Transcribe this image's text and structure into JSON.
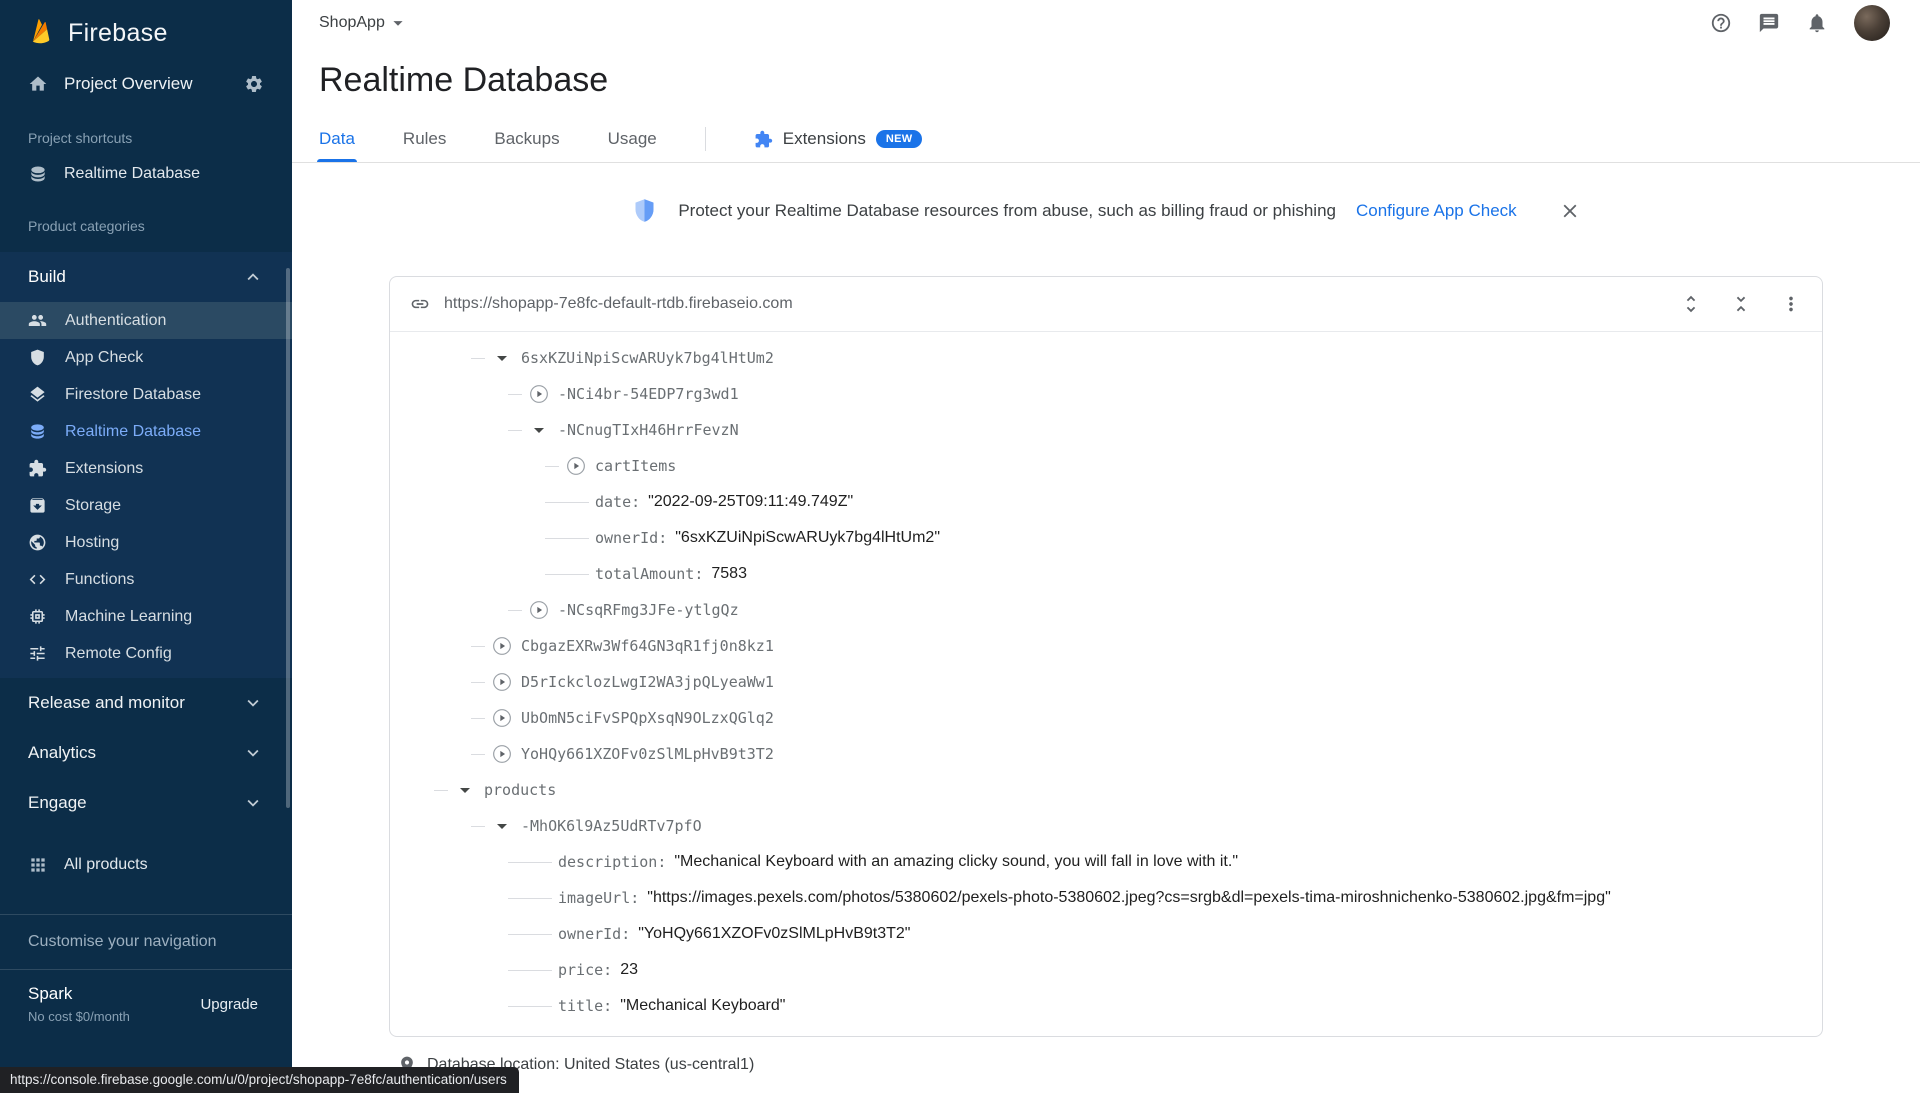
{
  "sidebar": {
    "brand": "Firebase",
    "project_overview": {
      "label": "Project Overview",
      "icon": "home-icon",
      "settings_icon": "gear-icon"
    },
    "shortcuts_label": "Project shortcuts",
    "shortcuts": [
      {
        "label": "Realtime Database",
        "icon": "database-icon"
      }
    ],
    "categories_label": "Product categories",
    "build": {
      "label": "Build",
      "items": [
        {
          "label": "Authentication",
          "icon": "people-icon",
          "state": "hover"
        },
        {
          "label": "App Check",
          "icon": "shield-icon"
        },
        {
          "label": "Firestore Database",
          "icon": "layers-icon"
        },
        {
          "label": "Realtime Database",
          "icon": "database-icon",
          "state": "active"
        },
        {
          "label": "Extensions",
          "icon": "puzzle-icon"
        },
        {
          "label": "Storage",
          "icon": "archive-icon"
        },
        {
          "label": "Hosting",
          "icon": "globe-icon"
        },
        {
          "label": "Functions",
          "icon": "code-icon"
        },
        {
          "label": "Machine Learning",
          "icon": "chip-icon"
        },
        {
          "label": "Remote Config",
          "icon": "tune-icon"
        }
      ]
    },
    "sections": [
      {
        "label": "Release and monitor"
      },
      {
        "label": "Analytics"
      },
      {
        "label": "Engage"
      }
    ],
    "all_products": "All products",
    "customise": "Customise your navigation",
    "plan": {
      "name": "Spark",
      "detail": "No cost $0/month",
      "upgrade_label": "Upgrade"
    }
  },
  "topbar": {
    "project_selector": "ShopApp"
  },
  "page": {
    "title": "Realtime Database",
    "tabs": [
      {
        "label": "Data",
        "active": true
      },
      {
        "label": "Rules"
      },
      {
        "label": "Backups"
      },
      {
        "label": "Usage"
      }
    ],
    "extensions_tab": {
      "label": "Extensions",
      "badge": "NEW"
    }
  },
  "banner": {
    "text": "Protect your Realtime Database resources from abuse, such as billing fraud or phishing",
    "action": "Configure App Check"
  },
  "db_card": {
    "url": "https://shopapp-7e8fc-default-rtdb.firebaseio.com",
    "tree": [
      {
        "depth": 1,
        "toggle": "expanded",
        "key": "6sxKZUiNpiScwARUyk7bg4lHtUm2"
      },
      {
        "depth": 2,
        "toggle": "collapsed",
        "key": "-NCi4br-54EDP7rg3wd1"
      },
      {
        "depth": 2,
        "toggle": "expanded",
        "key": "-NCnugTIxH46HrrFevzN"
      },
      {
        "depth": 3,
        "toggle": "collapsed",
        "key": "cartItems"
      },
      {
        "depth": 3,
        "toggle": "leaf",
        "key": "date",
        "value": "2022-09-25T09:11:49.749Z",
        "value_type": "string"
      },
      {
        "depth": 3,
        "toggle": "leaf",
        "key": "ownerId",
        "value": "6sxKZUiNpiScwARUyk7bg4lHtUm2",
        "value_type": "string"
      },
      {
        "depth": 3,
        "toggle": "leaf",
        "key": "totalAmount",
        "value": "7583",
        "value_type": "number"
      },
      {
        "depth": 2,
        "toggle": "collapsed",
        "key": "-NCsqRFmg3JFe-ytlgQz"
      },
      {
        "depth": 1,
        "toggle": "collapsed",
        "key": "CbgazEXRw3Wf64GN3qR1fj0n8kz1"
      },
      {
        "depth": 1,
        "toggle": "collapsed",
        "key": "D5rIckclozLwgI2WA3jpQLyeaWw1"
      },
      {
        "depth": 1,
        "toggle": "collapsed",
        "key": "UbOmN5ciFvSPQpXsqN9OLzxQGlq2"
      },
      {
        "depth": 1,
        "toggle": "collapsed",
        "key": "YoHQy661XZOFv0zSlMLpHvB9t3T2"
      },
      {
        "depth": 0,
        "toggle": "expanded",
        "key": "products"
      },
      {
        "depth": 1,
        "toggle": "expanded",
        "key": "-MhOK6l9Az5UdRTv7pfO"
      },
      {
        "depth": 2,
        "toggle": "leaf",
        "key": "description",
        "value": "Mechanical Keyboard with an amazing clicky sound, you will fall in love with it.",
        "value_type": "string"
      },
      {
        "depth": 2,
        "toggle": "leaf",
        "key": "imageUrl",
        "value": "https://images.pexels.com/photos/5380602/pexels-photo-5380602.jpeg?cs=srgb&dl=pexels-tima-miroshnichenko-5380602.jpg&fm=jpg",
        "value_type": "string"
      },
      {
        "depth": 2,
        "toggle": "leaf",
        "key": "ownerId",
        "value": "YoHQy661XZOFv0zSlMLpHvB9t3T2",
        "value_type": "string"
      },
      {
        "depth": 2,
        "toggle": "leaf",
        "key": "price",
        "value": "23",
        "value_type": "number"
      },
      {
        "depth": 2,
        "toggle": "leaf",
        "key": "title",
        "value": "Mechanical Keyboard",
        "value_type": "string"
      }
    ]
  },
  "footer": {
    "location": "Database location: United States (us-central1)"
  },
  "status_tooltip": "https://console.firebase.google.com/u/0/project/shopapp-7e8fc/authentication/users",
  "colors": {
    "accent": "#1a73e8",
    "sidebar_bg": "#0c2d48",
    "active_item": "#7cacf8",
    "badge_bg": "#1a73e8"
  }
}
